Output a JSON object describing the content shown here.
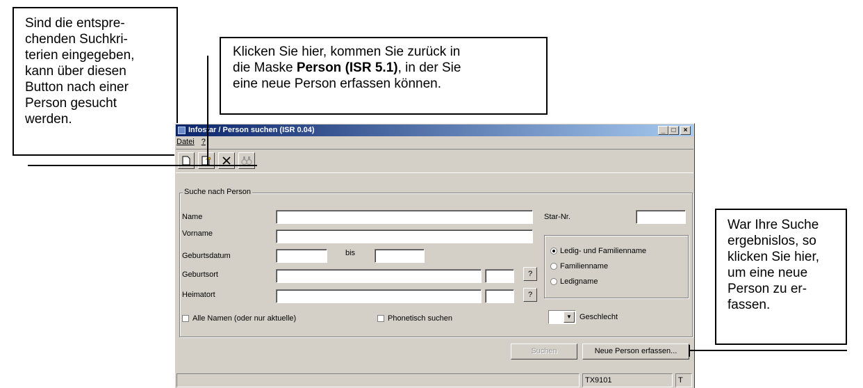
{
  "callouts": {
    "search_hint_lines": [
      "Sind die entspre-",
      "chenden Suchkri-",
      "terien eingegeben,",
      "kann über diesen",
      "Button nach einer",
      "Person gesucht",
      "werden."
    ],
    "new_person_pre": "Klicken Sie hier, kommen Sie zurück in",
    "new_person_mid": "die Maske ",
    "new_person_bold": "Person (ISR 5.1)",
    "new_person_post": ", in der Sie",
    "new_person_end": "eine neue Person erfassen können.",
    "result_lines": [
      "War Ihre Suche",
      "ergebnislos, so",
      "klicken Sie hier,",
      "um eine neue",
      "Person zu er-",
      "fassen."
    ]
  },
  "window": {
    "title": "Infostar / Person suchen  (ISR 0.04)",
    "controls": {
      "minimize": "_",
      "maximize": "□",
      "close": "×"
    }
  },
  "menu": [
    "Datei",
    "?"
  ],
  "toolbar": {
    "new_icon": "new-document-icon",
    "new_person_icon": "new-person-icon",
    "delete_icon": "delete-x-icon",
    "search_icon": "binoculars-icon"
  },
  "form": {
    "group_label": "Suche nach Person",
    "name_label": "Name",
    "name_value": "",
    "vorname_label": "Vorname",
    "vorname_value": "",
    "geburtsdatum_label": "Geburtsdatum",
    "bis_label": "bis",
    "geburtsort_label": "Geburtsort",
    "heimatort_label": "Heimatort",
    "star_nr_label": "Star-Nr.",
    "lookup_label": "?",
    "radio_options": [
      "Ledig- und Familienname",
      "Familienname",
      "Ledigname"
    ],
    "radio_selected": "Ledig- und Familienname",
    "alle_namen_label": "Alle Namen (oder nur aktuelle)",
    "phonetisch_label": "Phonetisch suchen",
    "geschlecht_label": "Geschlecht",
    "geschlecht_value": ""
  },
  "buttons": {
    "search_label": "Suchen",
    "new_person_label": "Neue Person erfassen..."
  },
  "statusbar": {
    "message": "",
    "code": "TX9101",
    "flag": "T"
  }
}
